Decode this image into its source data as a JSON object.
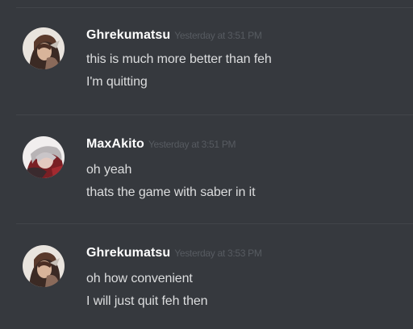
{
  "messages": [
    {
      "username": "Ghrekumatsu",
      "timestamp": "Yesterday at 3:51 PM",
      "avatar_icon": "anime-character-avatar",
      "lines": [
        "this is much more better than feh",
        "I'm quitting"
      ]
    },
    {
      "username": "MaxAkito",
      "timestamp": "Yesterday at 3:51 PM",
      "avatar_icon": "anime-character-avatar",
      "lines": [
        "oh yeah",
        "thats the game with saber in it"
      ]
    },
    {
      "username": "Ghrekumatsu",
      "timestamp": "Yesterday at 3:53 PM",
      "avatar_icon": "anime-character-avatar",
      "lines": [
        "oh how convenient",
        "I will just quit feh then"
      ]
    }
  ],
  "colors": {
    "background": "#36393e",
    "username": "#ffffff",
    "timestamp": "#575b61",
    "message_text": "#dcddde",
    "divider": "#42454a"
  }
}
